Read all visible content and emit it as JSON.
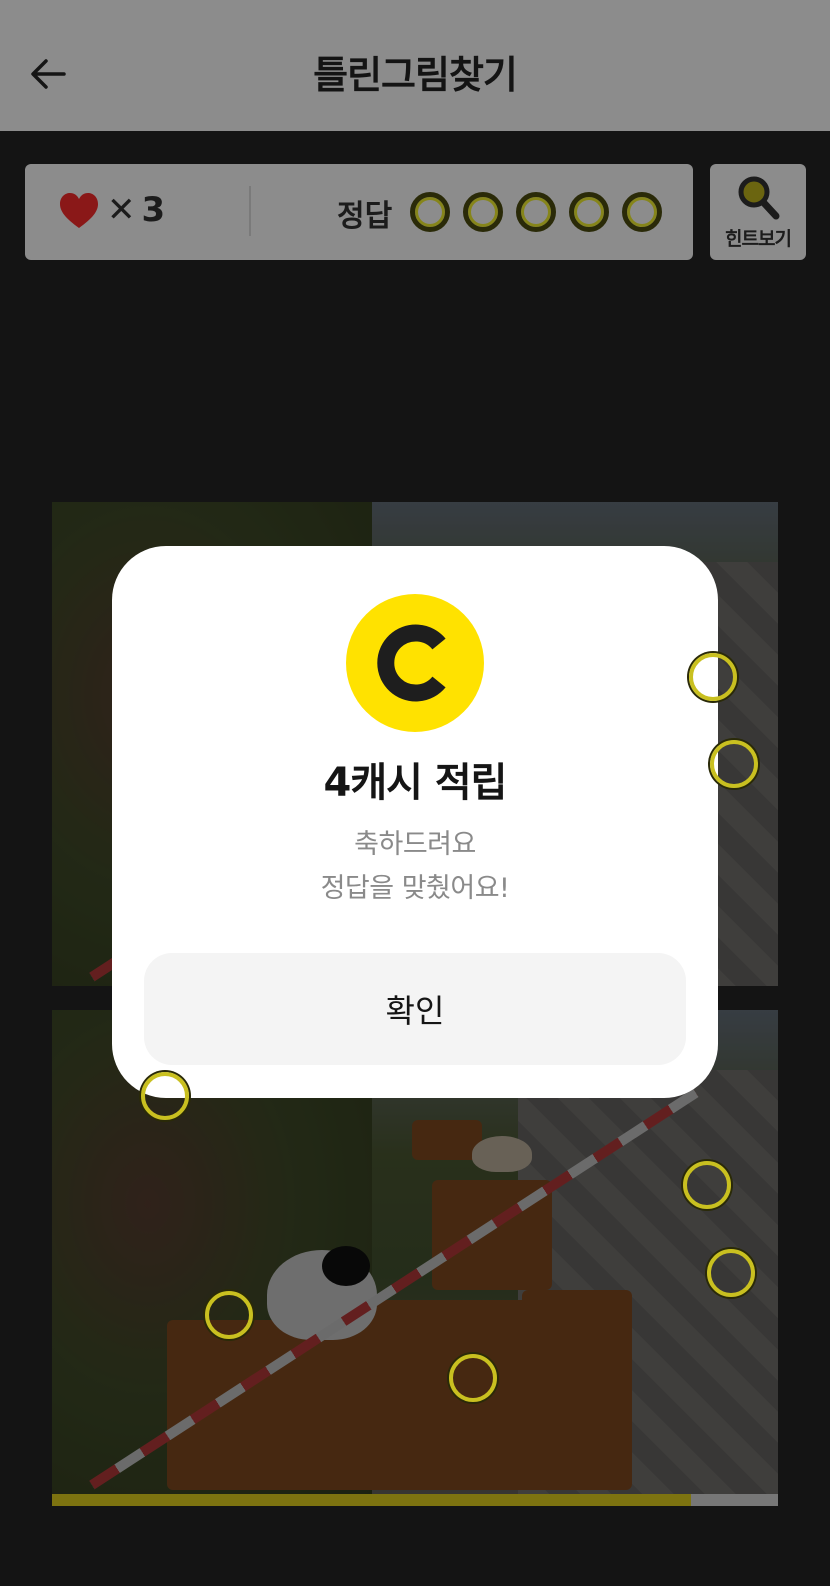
{
  "header": {
    "title": "틀린그림찾기",
    "back_icon": "arrow-left-icon"
  },
  "status": {
    "heart_icon": "heart-icon",
    "heart_color": "#c0201e",
    "lives_prefix": "✕",
    "lives_count": "3",
    "answer_label": "정답",
    "answer_total": 5,
    "answers_found": 0,
    "hint_label": "힌트보기",
    "hint_icon": "magnifier-icon"
  },
  "game": {
    "progress": 0.88,
    "accent": "#c9c020"
  },
  "modal": {
    "coin_icon": "cash-coin-icon",
    "coin_color": "#ffe200",
    "title": "4캐시 적립",
    "message_line1": "축하드려요",
    "message_line2": "정답을 맞췄어요!",
    "confirm_label": "확인"
  }
}
